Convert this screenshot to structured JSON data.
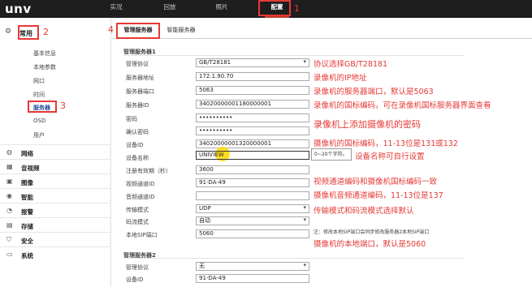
{
  "brand": {
    "logo": "unv"
  },
  "topnav": {
    "items": [
      {
        "label": "实况"
      },
      {
        "label": "回放"
      },
      {
        "label": "照片"
      },
      {
        "label": "配置",
        "active": true
      }
    ]
  },
  "annotations": {
    "n1": "1",
    "n2": "2",
    "n3": "3",
    "n4": "4",
    "protocol": "协议选择GB/T28181",
    "ip": "录像机的IP地址",
    "port": "录像机的服务器端口，默认是5063",
    "server_id": "录像机的国标编码，可在录像机国标服务器界面查看",
    "password": "录像机上添加摄像机的密码",
    "device_id": "摄像机的国标编码，11-13位是131或132",
    "device_name": "设备名称可自行设置",
    "video_channel": "视频通道编码和摄像机国标编码一致",
    "audio_channel": "摄像机音频通道编码，11-13位是137",
    "transport": "传输模式和码流模式选择默认",
    "local_port": "摄像机的本地端口，默认是5060"
  },
  "sidebar": {
    "section": {
      "label": "常用",
      "icon": "gear-icon"
    },
    "subitems": [
      {
        "label": "基本信息"
      },
      {
        "label": "本地参数"
      },
      {
        "label": "网口"
      },
      {
        "label": "时间"
      },
      {
        "label": "服务器",
        "selected": true
      },
      {
        "label": "OSD"
      },
      {
        "label": "用户"
      }
    ],
    "categories": [
      {
        "label": "网络",
        "icon": "globe-icon"
      },
      {
        "label": "音视频",
        "icon": "film-icon"
      },
      {
        "label": "图像",
        "icon": "image-icon"
      },
      {
        "label": "智能",
        "icon": "brain-icon"
      },
      {
        "label": "报警",
        "icon": "alarm-icon"
      },
      {
        "label": "存储",
        "icon": "storage-icon"
      },
      {
        "label": "安全",
        "icon": "shield-icon"
      },
      {
        "label": "系统",
        "icon": "system-icon"
      }
    ]
  },
  "tabs": [
    {
      "label": "管理服务器",
      "active": true
    },
    {
      "label": "智能服务器"
    }
  ],
  "server1": {
    "title": "管理服务器1",
    "fields": {
      "protocol": {
        "label": "管理协议",
        "value": "GB/T28181"
      },
      "server_addr": {
        "label": "服务器地址",
        "value": "172.1.90.70"
      },
      "server_port": {
        "label": "服务器端口",
        "value": "5063"
      },
      "server_id": {
        "label": "服务器ID",
        "value": "34020000001180000001"
      },
      "password": {
        "label": "密码",
        "value": "••••••••••"
      },
      "confirm_password": {
        "label": "确认密码",
        "value": "••••••••••"
      },
      "device_id": {
        "label": "设备ID",
        "value": "34020000001320000001"
      },
      "device_name": {
        "label": "设备名称",
        "value": "UNIVIEW"
      },
      "reg_period": {
        "label": "注册有效期（秒）",
        "value": "3600"
      },
      "video_channel_id": {
        "label": "视频通道ID",
        "value": "91-DA-49"
      },
      "audio_channel_id": {
        "label": "音频通道ID",
        "value": ""
      },
      "transport": {
        "label": "传输模式",
        "value": "UDP"
      },
      "stream_mode": {
        "label": "码流模式",
        "value": "自动"
      },
      "local_sip_port": {
        "label": "本地SIP端口",
        "value": "5060"
      }
    },
    "tooltip": "0~20个字符。",
    "note": "注：修改本地SIP端口会同步修改服务器2本地SIP端口"
  },
  "server2": {
    "title": "管理服务器2",
    "fields": {
      "protocol": {
        "label": "管理协议",
        "value": "无"
      },
      "device_id": {
        "label": "设备ID",
        "value": "91-DA-49"
      }
    }
  }
}
